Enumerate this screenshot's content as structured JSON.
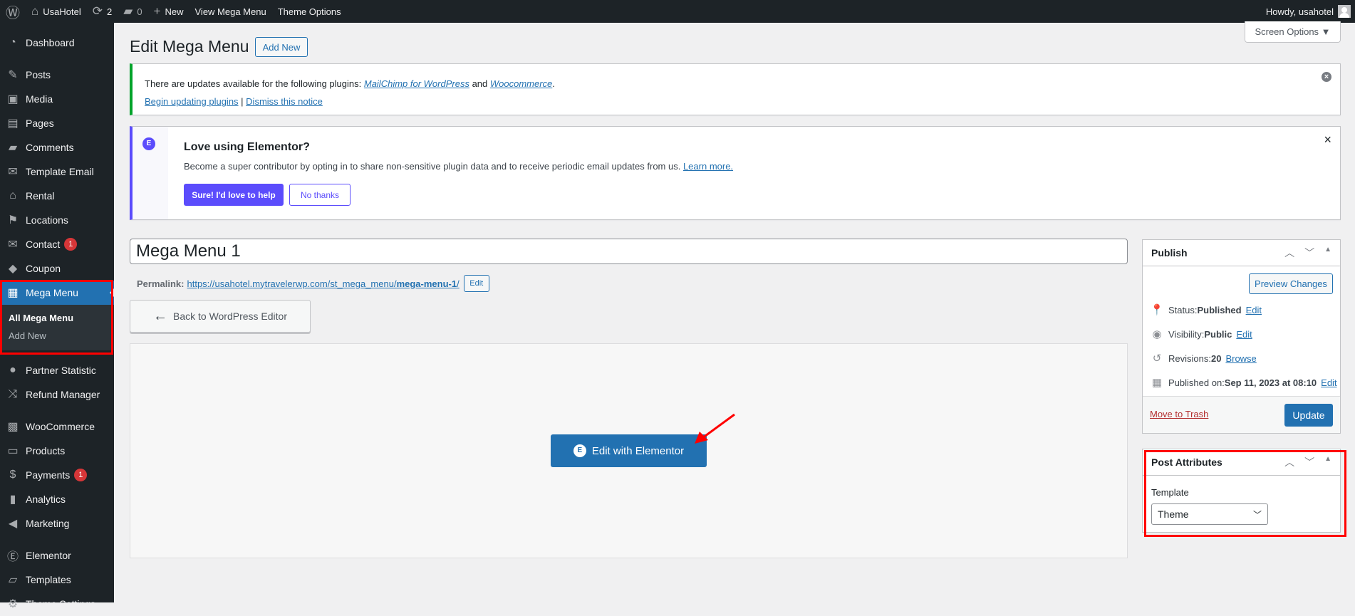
{
  "adminbar": {
    "site": "UsaHotel",
    "updates": "2",
    "comments": "0",
    "new": "New",
    "view": "View Mega Menu",
    "theme_options": "Theme Options",
    "howdy": "Howdy, usahotel"
  },
  "sidebar": {
    "items": [
      {
        "label": "Dashboard",
        "icon": "◔"
      },
      {
        "label": "Posts",
        "icon": "✎"
      },
      {
        "label": "Media",
        "icon": "▣"
      },
      {
        "label": "Pages",
        "icon": "▤"
      },
      {
        "label": "Comments",
        "icon": "▰"
      },
      {
        "label": "Template Email",
        "icon": "✉"
      },
      {
        "label": "Rental",
        "icon": "⌂"
      },
      {
        "label": "Locations",
        "icon": "⚑"
      },
      {
        "label": "Contact",
        "icon": "✉",
        "badge": "1"
      },
      {
        "label": "Coupon",
        "icon": "◆"
      },
      {
        "label": "Mega Menu",
        "icon": "▦"
      },
      {
        "label": "Partner Statistic",
        "icon": "●"
      },
      {
        "label": "Refund Manager",
        "icon": "⤨"
      },
      {
        "label": "WooCommerce",
        "icon": "▩"
      },
      {
        "label": "Products",
        "icon": "▭"
      },
      {
        "label": "Payments",
        "icon": "$",
        "badge": "1"
      },
      {
        "label": "Analytics",
        "icon": "▮"
      },
      {
        "label": "Marketing",
        "icon": "◀"
      },
      {
        "label": "Elementor",
        "icon": "Ⓔ"
      },
      {
        "label": "Templates",
        "icon": "▱"
      },
      {
        "label": "Theme Settings",
        "icon": "⚙"
      }
    ],
    "submenu": [
      "All Mega Menu",
      "Add New"
    ]
  },
  "header": {
    "title": "Edit Mega Menu",
    "add_new": "Add New",
    "screen_options": "Screen Options ▼"
  },
  "update_notice": {
    "text": "There are updates available for the following plugins: ",
    "plugin1": "MailChimp for WordPress",
    "and": " and ",
    "plugin2": "Woocommerce",
    "end": ".",
    "begin": "Begin updating plugins",
    "sep": " | ",
    "dismiss": "Dismiss this notice"
  },
  "elementor_notice": {
    "title": "Love using Elementor?",
    "text": "Become a super contributor by opting in to share non-sensitive plugin data and to receive periodic email updates from us. ",
    "learn": "Learn more.",
    "yes": "Sure! I'd love to help",
    "no": "No thanks",
    "accent": "#5b4cfc"
  },
  "post": {
    "title": "Mega Menu 1",
    "permalink_label": "Permalink:",
    "permalink_base": "https://usahotel.mytravelerwp.com/st_mega_menu/",
    "permalink_slug": "mega-menu-1",
    "permalink_end": "/",
    "edit": "Edit",
    "back": "Back to WordPress Editor",
    "edit_elementor": "Edit with Elementor"
  },
  "publish": {
    "title": "Publish",
    "preview": "Preview Changes",
    "status_label": "Status: ",
    "status": "Published",
    "visibility_label": "Visibility: ",
    "visibility": "Public",
    "revisions_label": "Revisions: ",
    "revisions": "20",
    "browse": "Browse",
    "published_label": "Published on: ",
    "published": "Sep 11, 2023 at 08:10",
    "edit": "Edit",
    "trash": "Move to Trash",
    "update": "Update"
  },
  "attributes": {
    "title": "Post Attributes",
    "template_label": "Template",
    "template": "Theme"
  }
}
